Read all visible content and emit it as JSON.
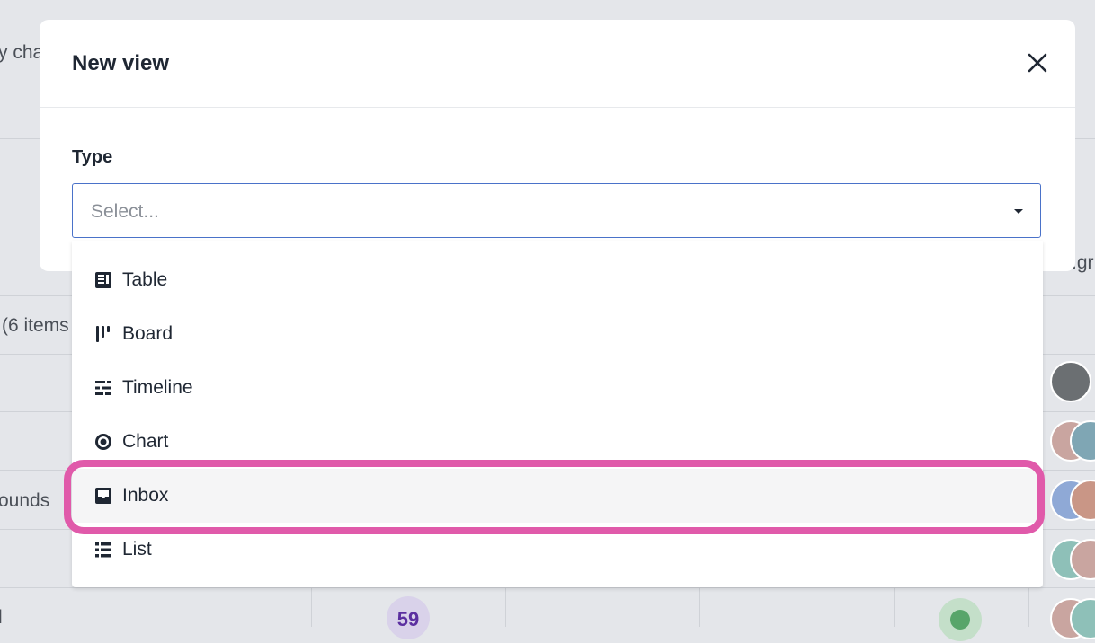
{
  "background": {
    "text_top": "y cha",
    "text_items": "(6 items",
    "text_rounds": "ounds",
    "text_l": "l",
    "text_right": ".gr",
    "badge_count": "59"
  },
  "modal": {
    "title": "New view",
    "field_label": "Type",
    "select_placeholder": "Select..."
  },
  "dropdown": {
    "options": [
      {
        "label": "Table",
        "icon": "table-icon"
      },
      {
        "label": "Board",
        "icon": "board-icon"
      },
      {
        "label": "Timeline",
        "icon": "timeline-icon"
      },
      {
        "label": "Chart",
        "icon": "chart-icon"
      },
      {
        "label": "Inbox",
        "icon": "inbox-icon"
      },
      {
        "label": "List",
        "icon": "list-icon"
      }
    ],
    "highlighted": "Inbox"
  },
  "colors": {
    "accent_border": "#4a72c9",
    "highlight": "#e05aaa"
  }
}
